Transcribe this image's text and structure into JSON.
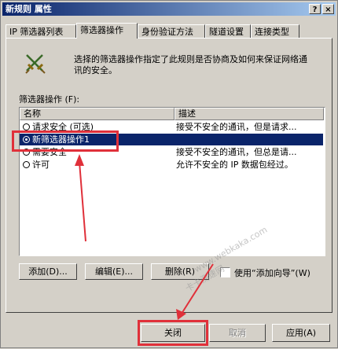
{
  "window": {
    "title": "新规则 属性",
    "help_glyph": "?",
    "close_glyph": "×"
  },
  "tabs": [
    {
      "label": "IP 筛选器列表",
      "active": false
    },
    {
      "label": "筛选器操作",
      "active": true
    },
    {
      "label": "身份验证方法",
      "active": false
    },
    {
      "label": "隧道设置",
      "active": false
    },
    {
      "label": "连接类型",
      "active": false
    }
  ],
  "description": "选择的筛选器操作指定了此规则是否协商及如何来保证网络通讯的安全。",
  "list_label": "筛选器操作 (F):",
  "list": {
    "columns": [
      "名称",
      "描述"
    ],
    "rows": [
      {
        "name": "请求安全 (可选)",
        "desc": "接受不安全的通讯，但是请求...",
        "selected": false
      },
      {
        "name": "新筛选器操作1",
        "desc": "",
        "selected": true
      },
      {
        "name": "需要安全",
        "desc": "接受不安全的通讯，但总是请...",
        "selected": false
      },
      {
        "name": "许可",
        "desc": "允许不安全的 IP 数据包经过。",
        "selected": false
      }
    ]
  },
  "buttons": {
    "add": "添加(D)...",
    "edit": "编辑(E)...",
    "remove": "删除(R)",
    "wizard_label": "使用“添加向导”(W)",
    "close": "关闭",
    "cancel": "取消",
    "apply": "应用(A)"
  },
  "watermark": "www.webkaka.com",
  "watermark2": "卡卡测速网",
  "colors": {
    "selection": "#0a246a",
    "annotation": "#e0303a",
    "face": "#d4d0c8"
  },
  "icons": {
    "filter_action": "crossed-swords-icon"
  }
}
